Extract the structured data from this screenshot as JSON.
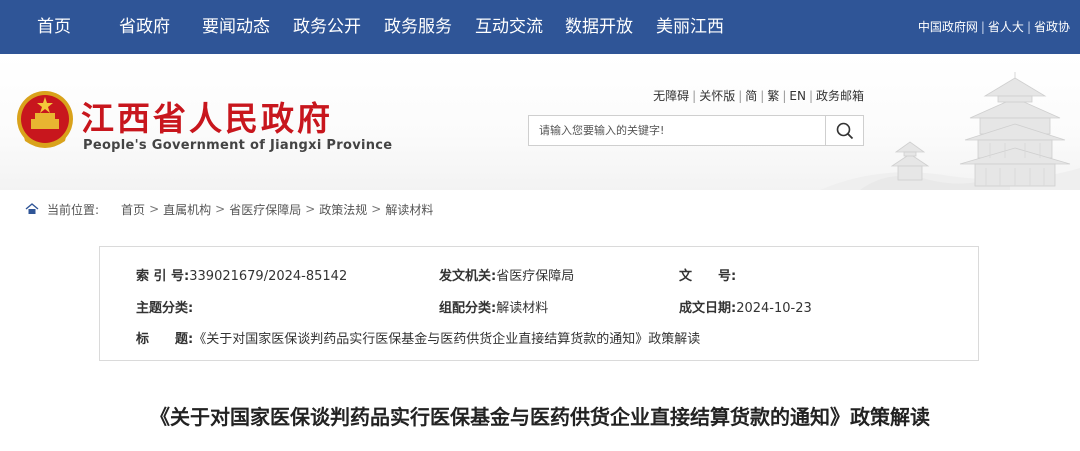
{
  "topnav": {
    "items": [
      "首页",
      "省政府",
      "要闻动态",
      "政务公开",
      "政务服务",
      "互动交流",
      "数据开放",
      "美丽江西"
    ],
    "links": [
      "中国政府网",
      "省人大",
      "省政协"
    ]
  },
  "header": {
    "title": "江西省人民政府",
    "subtitle": "People's Government of Jiangxi Province",
    "access_links": [
      "无障碍",
      "关怀版",
      "简",
      "繁",
      "EN",
      "政务邮箱"
    ],
    "search": {
      "placeholder": "请输入您要输入的关键字!"
    },
    "icons": {
      "emblem": "national-emblem-icon",
      "search": "search-icon",
      "banner": "pavilion-illustration",
      "home": "home-icon"
    },
    "colors": {
      "nav": "#2f5597",
      "title": "#c8161d"
    }
  },
  "breadcrumb": {
    "label": "当前位置:",
    "items": [
      "首页",
      "直属机构",
      "省医疗保障局",
      "政策法规",
      "解读材料"
    ]
  },
  "info": {
    "index_label": "索 引 号:",
    "index_value": "339021679/2024-85142",
    "issuer_label": "发文机关:",
    "issuer_value": "省医疗保障局",
    "docno_label": "文　　号:",
    "docno_value": "",
    "topic_label": "主题分类:",
    "topic_value": "",
    "category_label": "组配分类:",
    "category_value": "解读材料",
    "date_label": "成文日期:",
    "date_value": "2024-10-23",
    "title_label": "标　　题:",
    "title_value": "《关于对国家医保谈判药品实行医保基金与医药供货企业直接结算货款的通知》政策解读"
  },
  "article": {
    "title": "《关于对国家医保谈判药品实行医保基金与医药供货企业直接结算货款的通知》政策解读"
  }
}
